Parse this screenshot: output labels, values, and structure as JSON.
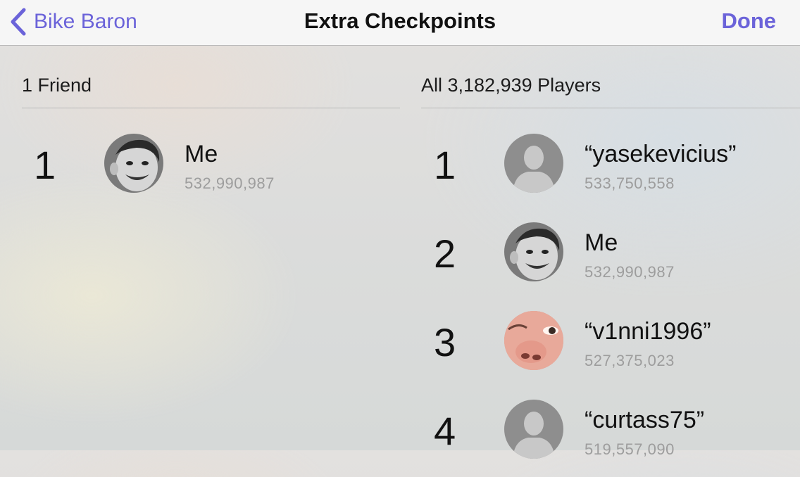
{
  "navbar": {
    "back_label": "Bike Baron",
    "title": "Extra Checkpoints",
    "done_label": "Done"
  },
  "friends": {
    "header": "1 Friend",
    "rows": [
      {
        "rank": "1",
        "name": "Me",
        "score": "532,990,987",
        "avatar": "photo"
      }
    ]
  },
  "all_players": {
    "header": "All 3,182,939 Players",
    "rows": [
      {
        "rank": "1",
        "name": "“yasekevicius”",
        "score": "533,750,558",
        "avatar": "placeholder"
      },
      {
        "rank": "2",
        "name": "Me",
        "score": "532,990,987",
        "avatar": "photo"
      },
      {
        "rank": "3",
        "name": "“v1nni1996”",
        "score": "527,375,023",
        "avatar": "photo"
      },
      {
        "rank": "4",
        "name": "“curtass75”",
        "score": "519,557,090",
        "avatar": "placeholder"
      }
    ]
  },
  "colors": {
    "accent": "#6b63d9",
    "navbar_bg": "#f6f6f6",
    "score_text": "#9d9d9d"
  }
}
